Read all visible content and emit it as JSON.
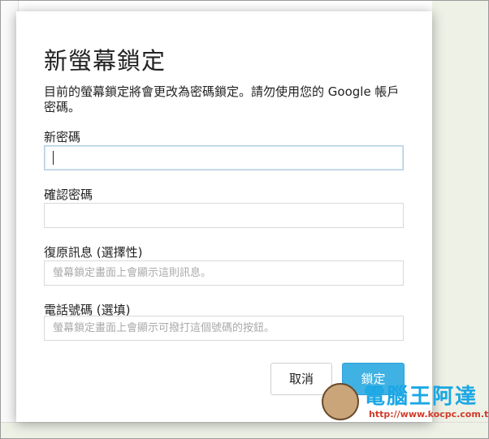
{
  "dialog": {
    "title": "新螢幕鎖定",
    "description": "目前的螢幕鎖定將會更改為密碼鎖定。請勿使用您的 Google 帳戶密碼。",
    "fields": [
      {
        "label": "新密碼",
        "value": "",
        "placeholder": ""
      },
      {
        "label": "確認密碼",
        "value": "",
        "placeholder": ""
      },
      {
        "label": "復原訊息 (選擇性)",
        "value": "",
        "placeholder": "螢幕鎖定畫面上會顯示這則訊息。"
      },
      {
        "label": "電話號碼 (選填)",
        "value": "",
        "placeholder": "螢幕鎖定畫面上會顯示可撥打這個號碼的按鈕。"
      }
    ],
    "cancel_label": "取消",
    "lock_label": "鎖定"
  },
  "watermark": {
    "text": "電腦王阿達",
    "url": "http://www.kocpc.com.tw"
  },
  "colors": {
    "accent": "#3fb1e3",
    "watermark_blue": "#1aa7e5",
    "watermark_red": "#d23a2a"
  }
}
